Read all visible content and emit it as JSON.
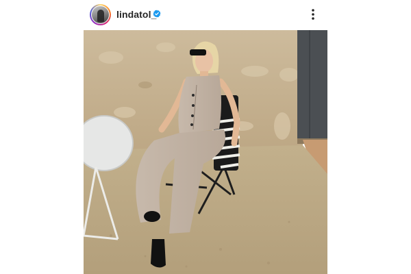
{
  "post": {
    "username": "lindatol_",
    "verified": true,
    "icons": {
      "verified": "verified-badge-icon",
      "more": "more-options-icon"
    }
  },
  "colors": {
    "verified_blue": "#1d9bf0",
    "text": "#262626"
  }
}
